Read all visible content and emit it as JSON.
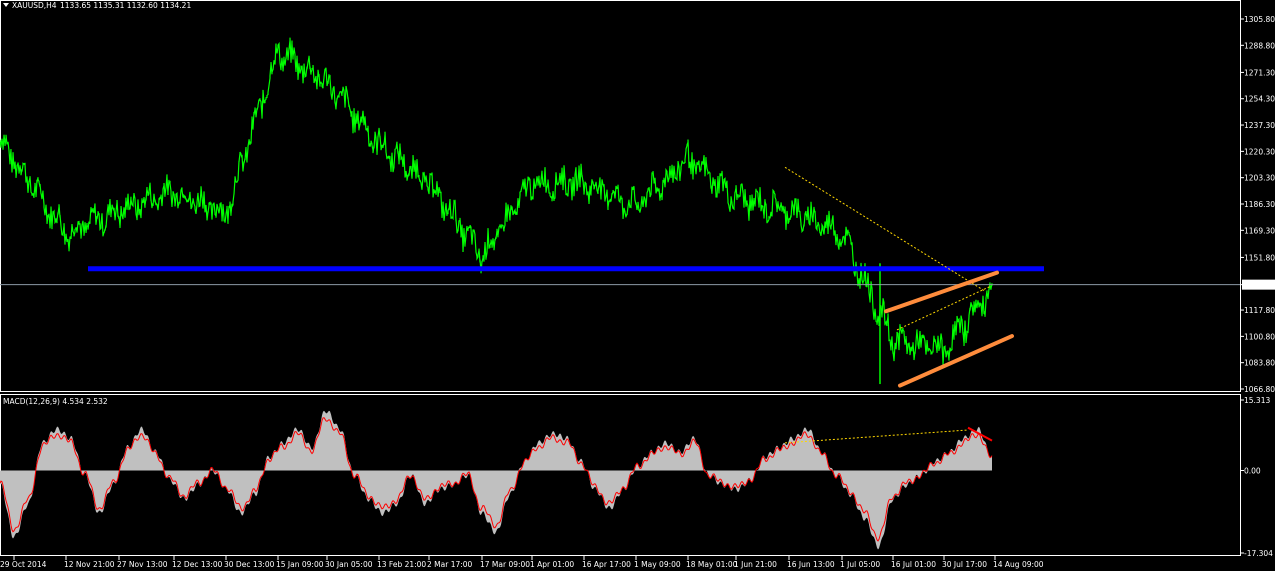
{
  "header": {
    "symbol": "XAUUSD,H4",
    "quote": "1133.65 1135.31 1132.60 1134.21"
  },
  "colors": {
    "background": "#000000",
    "price": "#00ff00",
    "support": "#0000ff",
    "channel": "#ff8c3c",
    "dashed": "#ffd700",
    "macd_hist": "#c0c0c0",
    "macd_signal": "#ff0000",
    "frame": "#ffffff"
  },
  "chart_data": [
    {
      "type": "line",
      "title": "XAUUSD,H4",
      "series": [
        {
          "name": "XAUUSD",
          "x": [
            "29 Oct 2014",
            "12 Nov 21:00",
            "27 Nov 13:00",
            "12 Dec 13:00",
            "30 Dec 13:00",
            "15 Jan 09:00",
            "30 Jan 05:00",
            "13 Feb 21:00",
            "2 Mar 17:00",
            "17 Mar 09:00",
            "1 Apr 01:00",
            "16 Apr 17:00",
            "1 May 09:00",
            "18 May 01:00",
            "1 Jun 21:00",
            "16 Jun 13:00",
            "1 Jul 05:00",
            "16 Jul 01:00",
            "30 Jul 17:00",
            "14 Aug 09:00"
          ],
          "values": [
            1228,
            1168,
            1182,
            1195,
            1180,
            1285,
            1265,
            1225,
            1200,
            1152,
            1200,
            1200,
            1185,
            1215,
            1190,
            1182,
            1168,
            1098,
            1092,
            1134
          ]
        }
      ],
      "yticks": [
        1305.8,
        1288.8,
        1271.3,
        1254.3,
        1237.3,
        1220.3,
        1203.3,
        1186.3,
        1169.3,
        1151.8,
        1134.21,
        1117.8,
        1100.8,
        1083.8,
        1066.8
      ],
      "current_price": 1134.21,
      "support_level": 1144.5,
      "ylim": [
        1064,
        1314
      ],
      "xtick_labels": [
        "29 Oct 2014",
        "12 Nov 21:00",
        "27 Nov 13:00",
        "12 Dec 13:00",
        "30 Dec 13:00",
        "15 Jan 09:00",
        "30 Jan 05:00",
        "13 Feb 21:00",
        "2 Mar 17:00",
        "17 Mar 09:00",
        "1 Apr 01:00",
        "16 Apr 17:00",
        "1 May 09:00",
        "18 May 01:00",
        "1 Jun 21:00",
        "16 Jun 13:00",
        "1 Jul 05:00",
        "16 Jul 01:00",
        "30 Jul 17:00",
        "14 Aug 09:00"
      ],
      "grid": false
    },
    {
      "type": "bar",
      "title": "MACD(12,26,9) 4.534 2.532",
      "label": "MACD(12,26,9)",
      "macd_value": 4.534,
      "signal_value": 2.532,
      "yticks": [
        15.313,
        0.0,
        -17.304
      ],
      "ylim": [
        -17.304,
        15.313
      ],
      "series": [
        {
          "name": "MACD",
          "values": [
            -3,
            -14,
            -7,
            6,
            9,
            7,
            -1,
            -9,
            -3,
            5,
            9,
            4,
            -2,
            -6,
            -3,
            0,
            -4,
            -9,
            -5,
            3,
            6,
            9,
            5,
            13,
            9,
            -1,
            -6,
            -9,
            -7,
            -1,
            -7,
            -4,
            -3,
            -1,
            -9,
            -13,
            -5,
            2,
            6,
            8,
            7,
            2,
            -4,
            -8,
            -4,
            1,
            4,
            6,
            4,
            7,
            -1,
            -3,
            -4,
            -2,
            3,
            5,
            7,
            9,
            4,
            -1,
            -5,
            -10,
            -16,
            -6,
            -3,
            -1,
            2,
            4,
            7,
            9,
            3
          ]
        }
      ]
    }
  ]
}
